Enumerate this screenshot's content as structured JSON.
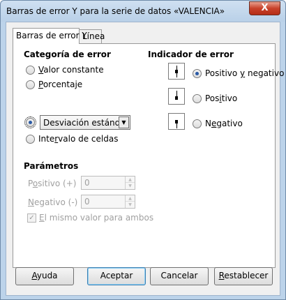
{
  "window": {
    "title": "Barras de error Y para la serie de datos «VALENCIA»",
    "close_label": "X"
  },
  "tabs": [
    {
      "label": "Barras de error Y",
      "active": true
    },
    {
      "label": "Línea",
      "active": false
    }
  ],
  "error_category": {
    "title": "Categoría de error",
    "options": [
      {
        "label": "Valor constante",
        "selected": false
      },
      {
        "label": "Porcentaje",
        "selected": false
      },
      {
        "label": "Desviación estándar",
        "selected": true
      },
      {
        "label": "Intervalo de celdas",
        "selected": false
      }
    ],
    "function_select": {
      "value": "Desviación estándar"
    }
  },
  "error_indicator": {
    "title": "Indicador de error",
    "options": [
      {
        "label": "Positivo y negativo",
        "selected": true,
        "icon": "error-bar-both-icon"
      },
      {
        "label": "Positivo",
        "selected": false,
        "icon": "error-bar-positive-icon"
      },
      {
        "label": "Negativo",
        "selected": false,
        "icon": "error-bar-negative-icon"
      }
    ]
  },
  "parameters": {
    "title": "Parámetros",
    "positive": {
      "label": "Positivo (+)",
      "value": "0"
    },
    "negative": {
      "label": "Negativo (-)",
      "value": "0"
    },
    "same_value": {
      "label": "El mismo valor para ambos",
      "checked": true
    }
  },
  "buttons": {
    "help": "Ayuda",
    "ok": "Aceptar",
    "cancel": "Cancelar",
    "reset": "Restablecer"
  },
  "colors": {
    "frame": "#bcd3ea",
    "close_button": "#c8412a",
    "radio_selected": "#2a5aa5",
    "default_button_border": "#3c7fb1"
  }
}
